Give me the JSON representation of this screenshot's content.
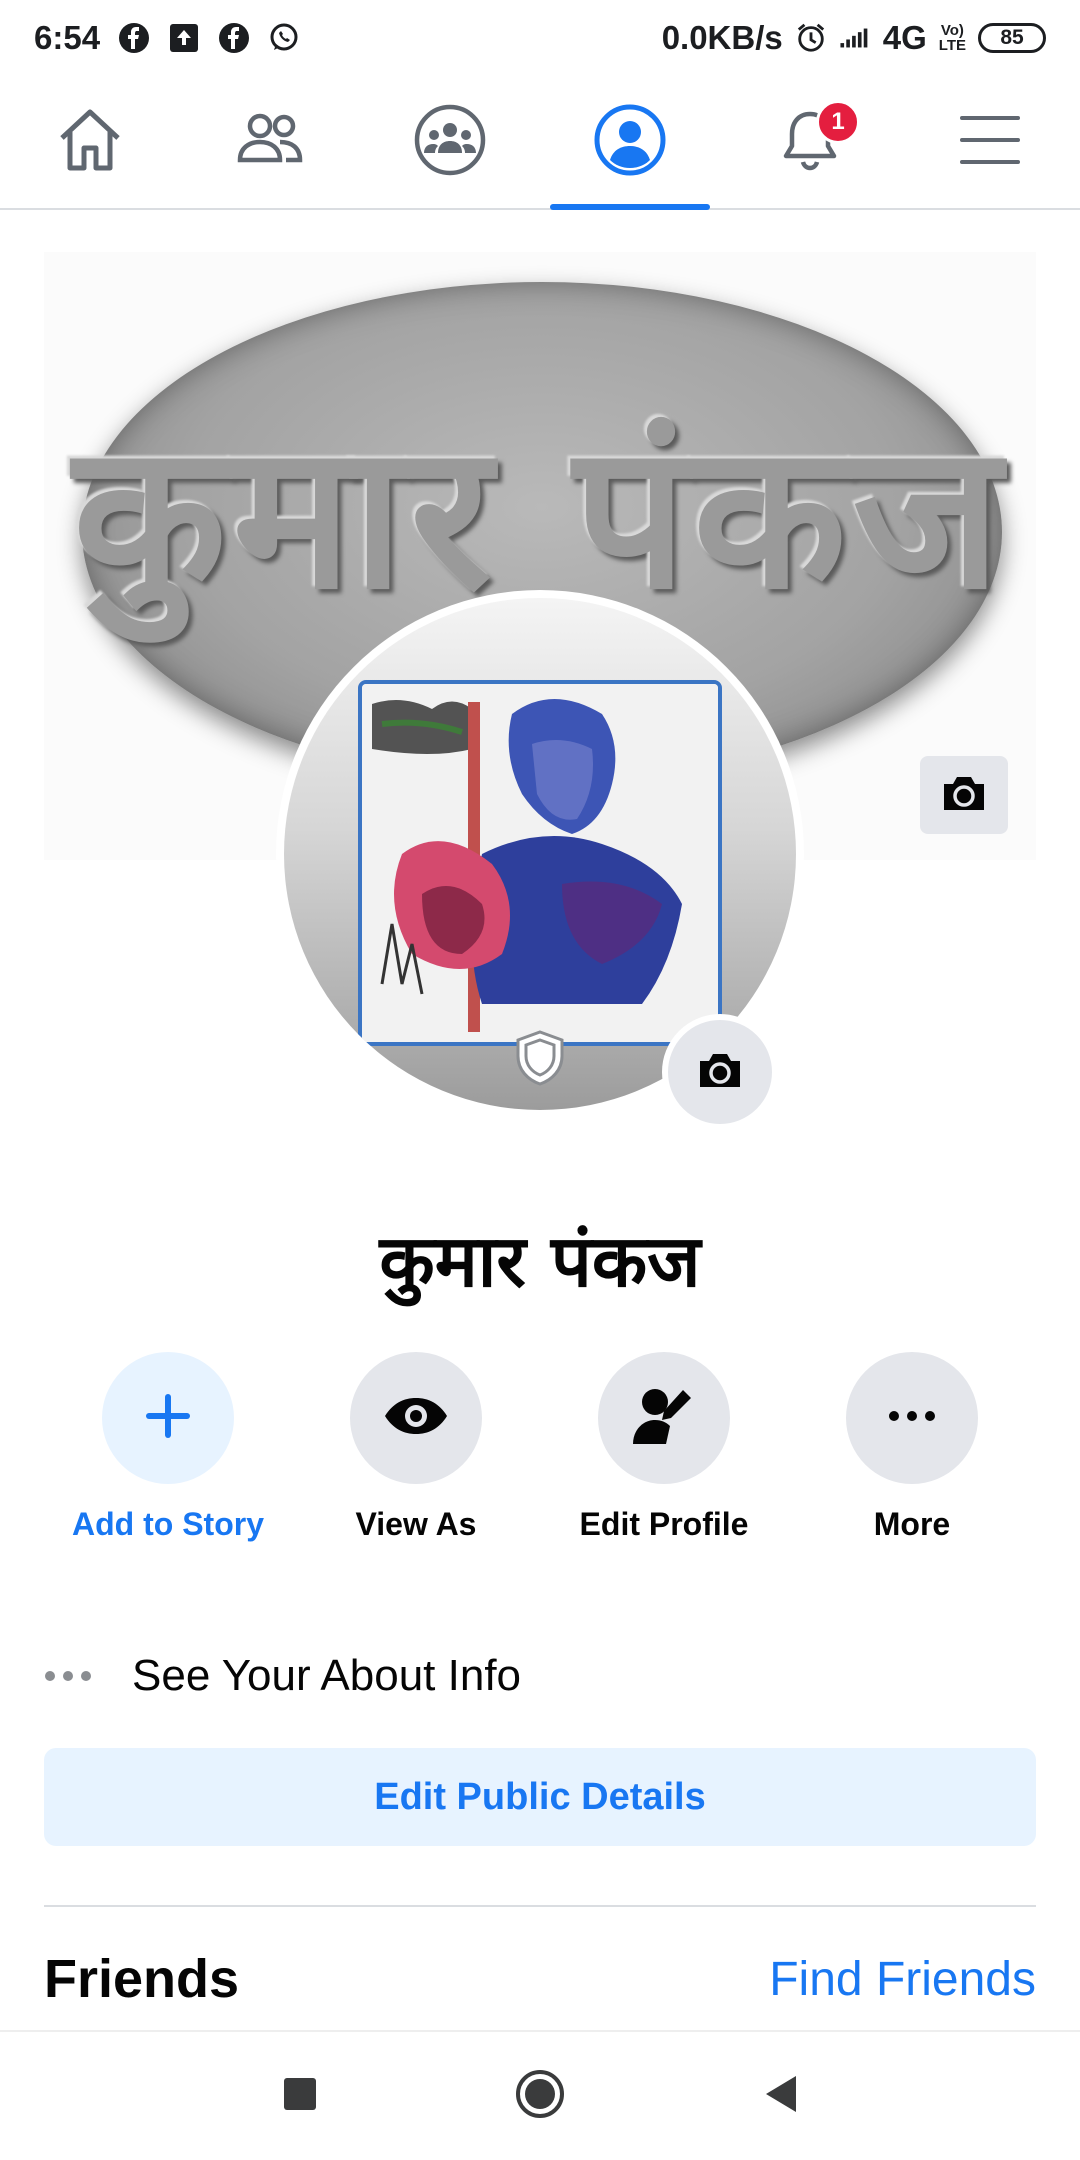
{
  "status_bar": {
    "time": "6:54",
    "network_speed": "0.0KB/s",
    "network_type": "4G",
    "volte_top": "Vo)",
    "volte_bottom": "LTE",
    "battery": "85",
    "notification_icons": [
      "facebook-icon",
      "upload-icon",
      "facebook-icon",
      "whatsapp-icon"
    ]
  },
  "top_nav": {
    "tabs": [
      "home-icon",
      "friends-icon",
      "groups-icon",
      "profile-icon",
      "notifications-icon",
      "menu-icon"
    ],
    "active_tab": "profile-icon",
    "notification_count": "1"
  },
  "cover": {
    "text": "कुमार पंकज"
  },
  "profile": {
    "name": "कुमार पंकज"
  },
  "actions": [
    {
      "label": "Add to Story",
      "icon": "plus-icon"
    },
    {
      "label": "View As",
      "icon": "eye-icon"
    },
    {
      "label": "Edit Profile",
      "icon": "edit-profile-icon"
    },
    {
      "label": "More",
      "icon": "more-dots-icon"
    }
  ],
  "about": {
    "label": "See Your About Info"
  },
  "edit_public_details": "Edit Public Details",
  "friends": {
    "title": "Friends",
    "find_friends": "Find Friends"
  },
  "colors": {
    "accent": "#1877f2",
    "badge": "#e41e3f",
    "button_bg": "#e4e6eb",
    "light_blue": "#e7f3ff"
  }
}
